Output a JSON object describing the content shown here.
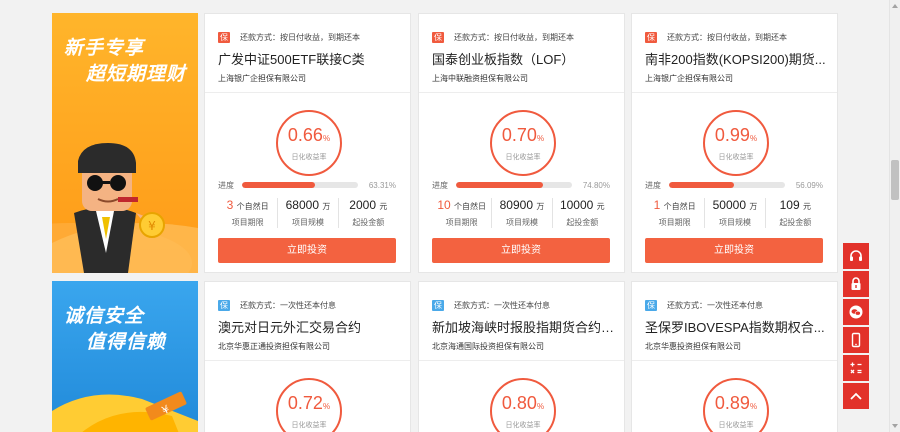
{
  "banners": [
    {
      "line1": "新手专享",
      "line2": "超短期理财"
    },
    {
      "line1": "诚信安全",
      "line2": "值得信赖"
    }
  ],
  "progress_label": "进度",
  "rate_label": "日化收益率",
  "invest_label": "立即投资",
  "stat_labels": {
    "term": "项目期限",
    "scale": "项目规模",
    "min": "起投金额"
  },
  "section1": [
    {
      "tag": "保",
      "repay": "还款方式：按日付收益，到期还本",
      "name": "广发中证500ETF联接C类",
      "company": "上海银广企担保有限公司",
      "rate": "0.66",
      "pct": "%",
      "progress_value": "63.31%",
      "progress": 0.6331,
      "term": "3",
      "term_unit": "个自然日",
      "scale": "68000",
      "scale_unit": "万",
      "min": "2000",
      "min_unit": "元"
    },
    {
      "tag": "保",
      "repay": "还款方式：按日付收益，到期还本",
      "name": "国泰创业板指数（LOF）",
      "company": "上海中联融资担保有限公司",
      "rate": "0.70",
      "pct": "%",
      "progress_value": "74.80%",
      "progress": 0.748,
      "term": "10",
      "term_unit": "个自然日",
      "scale": "80900",
      "scale_unit": "万",
      "min": "10000",
      "min_unit": "元"
    },
    {
      "tag": "保",
      "repay": "还款方式：按日付收益，到期还本",
      "name": "南非200指数(KOPSI200)期货...",
      "company": "上海银广企担保有限公司",
      "rate": "0.99",
      "pct": "%",
      "progress_value": "56.09%",
      "progress": 0.5609,
      "term": "1",
      "term_unit": "个自然日",
      "scale": "50000",
      "scale_unit": "万",
      "min": "109",
      "min_unit": "元"
    }
  ],
  "section2": [
    {
      "tag": "保",
      "repay": "还款方式：一次性还本付息",
      "name": "澳元对日元外汇交易合约",
      "company": "北京华惠正通投资担保有限公司",
      "rate": "0.72",
      "pct": "%"
    },
    {
      "tag": "保",
      "repay": "还款方式：一次性还本付息",
      "name": "新加坡海峡时报股指期货合约(...",
      "company": "北京海通国际投资担保有限公司",
      "rate": "0.80",
      "pct": "%"
    },
    {
      "tag": "保",
      "repay": "还款方式：一次性还本付息",
      "name": "圣保罗IBOVESPA指数期权合...",
      "company": "北京华惠投资担保有限公司",
      "rate": "0.89",
      "pct": "%"
    }
  ],
  "colors": {
    "accent": "#f05a3e",
    "orange_banner": "#ff9a17",
    "blue_banner": "#1f88d8",
    "toolbar": "#e2322a"
  },
  "toolbar_icons": [
    "headset-icon",
    "lock-icon",
    "chat-icon",
    "mobile-icon",
    "calculator-icon",
    "arrow-up-icon"
  ]
}
